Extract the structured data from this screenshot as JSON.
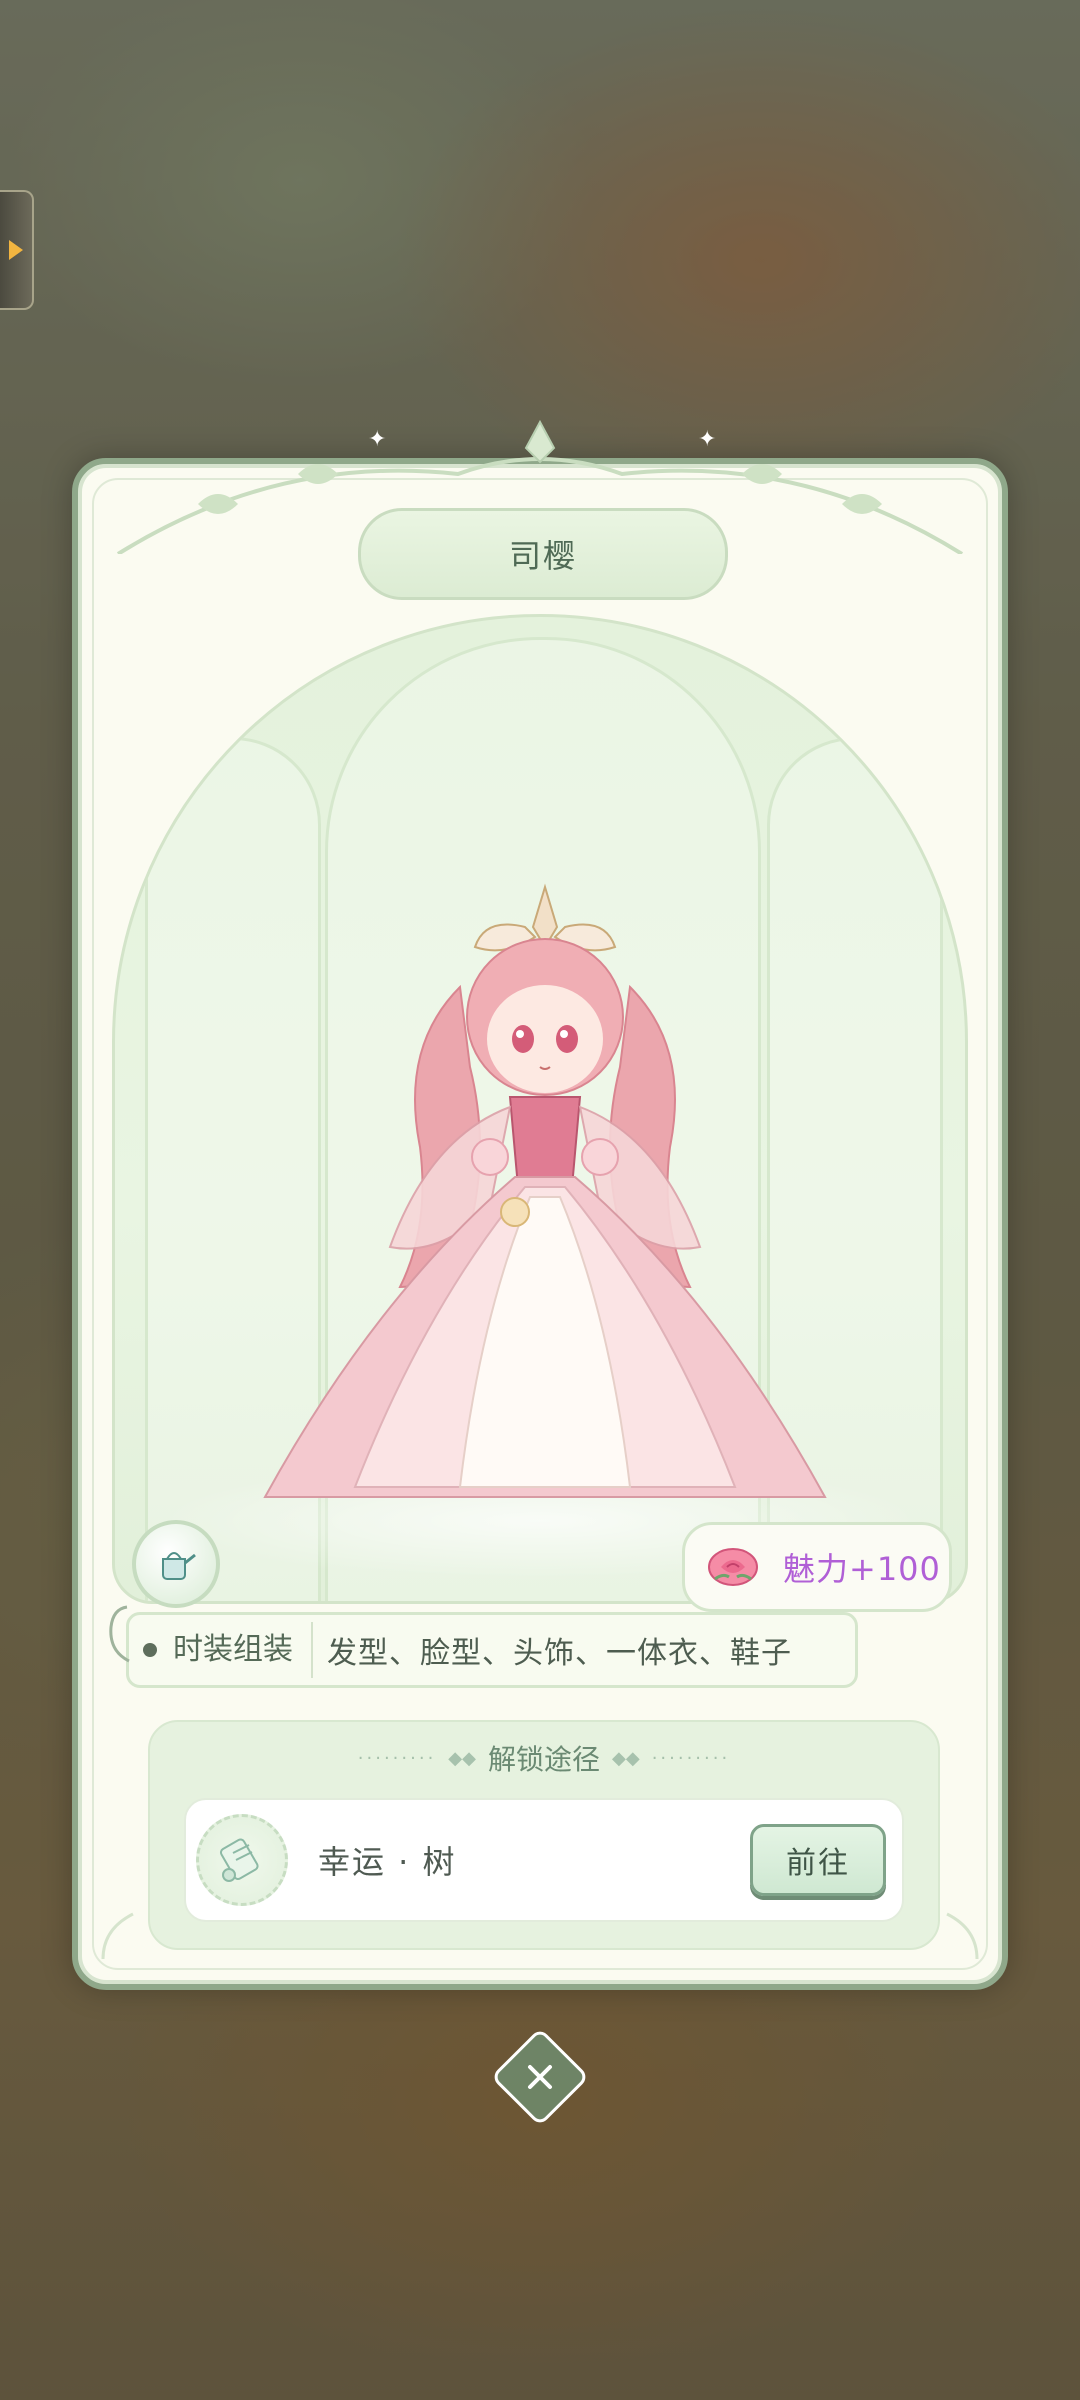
{
  "card": {
    "title": "司樱",
    "charm": {
      "label": "魅力+100",
      "icon": "rose-icon"
    },
    "parts": {
      "label": "时装组装",
      "value": "发型、脸型、头饰、一体衣、鞋子"
    },
    "unlock": {
      "heading": "解锁途径",
      "source": "幸运 · 树",
      "button_label": "前往",
      "icon": "scroll-icon"
    },
    "badge_icon": "watering-can-icon"
  },
  "side_tab_icon": "play-arrow-icon",
  "close_icon": "close-icon",
  "colors": {
    "charm_text": "#b05fd6",
    "card_border": "#8fa88a",
    "panel_bg": "#e6f2df"
  }
}
